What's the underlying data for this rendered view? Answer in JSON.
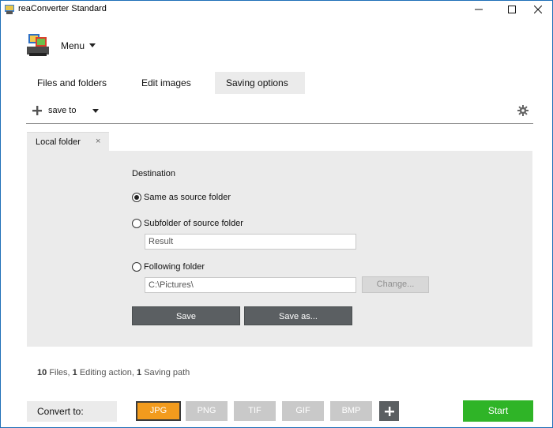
{
  "window": {
    "title": "reaConverter Standard"
  },
  "menu": {
    "label": "Menu"
  },
  "tabs": [
    {
      "label": "Files and folders",
      "active": false
    },
    {
      "label": "Edit images",
      "active": false
    },
    {
      "label": "Saving options",
      "active": true
    }
  ],
  "toolbar": {
    "save_to_label": "save to"
  },
  "subtab": {
    "label": "Local folder",
    "close_glyph": "×"
  },
  "destination": {
    "heading": "Destination",
    "options": [
      {
        "label": "Same as source folder",
        "checked": true
      },
      {
        "label": "Subfolder of source folder",
        "checked": false
      },
      {
        "label": "Following folder",
        "checked": false
      }
    ],
    "subfolder_value": "Result",
    "folder_value": "C:\\Pictures\\",
    "change_label": "Change...",
    "save_label": "Save",
    "save_as_label": "Save as..."
  },
  "summary": {
    "files_count": "10",
    "files_label": "Files,",
    "actions_count": "1",
    "actions_label": "Editing action,",
    "paths_count": "1",
    "paths_label": "Saving path"
  },
  "convert": {
    "label": "Convert to:",
    "formats": [
      {
        "label": "JPG",
        "active": true
      },
      {
        "label": "PNG",
        "active": false
      },
      {
        "label": "TIF",
        "active": false
      },
      {
        "label": "GIF",
        "active": false
      },
      {
        "label": "BMP",
        "active": false
      }
    ],
    "start_label": "Start"
  },
  "colors": {
    "accent_orange": "#f29b1d",
    "start_green": "#2fb427",
    "dark_button": "#5b5f62",
    "panel_gray": "#ebebeb"
  }
}
